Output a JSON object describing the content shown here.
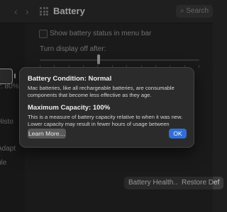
{
  "window": {
    "title": "Battery",
    "search_placeholder": "Search",
    "back_glyph": "‹",
    "forward_glyph": "›"
  },
  "sidebar": {
    "labels": [
      "y: 80%",
      "Histo",
      "Adapt",
      "ule"
    ]
  },
  "main": {
    "show_status_label": "Show battery status in menu bar",
    "turn_display_label": "Turn display off after:",
    "slider_fraction": 0.37,
    "health_button": "Battery Health…",
    "restore_button": "Restore Def"
  },
  "dialog": {
    "condition_title": "Battery Condition: Normal",
    "condition_text": "Mac batteries, like all rechargeable batteries, are consumable components that become less effective as they age.",
    "capacity_title": "Maximum Capacity: 100%",
    "capacity_text": "This is a measure of battery capacity relative to when it was new. Lower capacity may result in fewer hours of usage between charges.",
    "learn_more": "Learn More…",
    "ok": "OK"
  },
  "colors": {
    "accent": "#2f6fd8",
    "background": "#242424"
  }
}
